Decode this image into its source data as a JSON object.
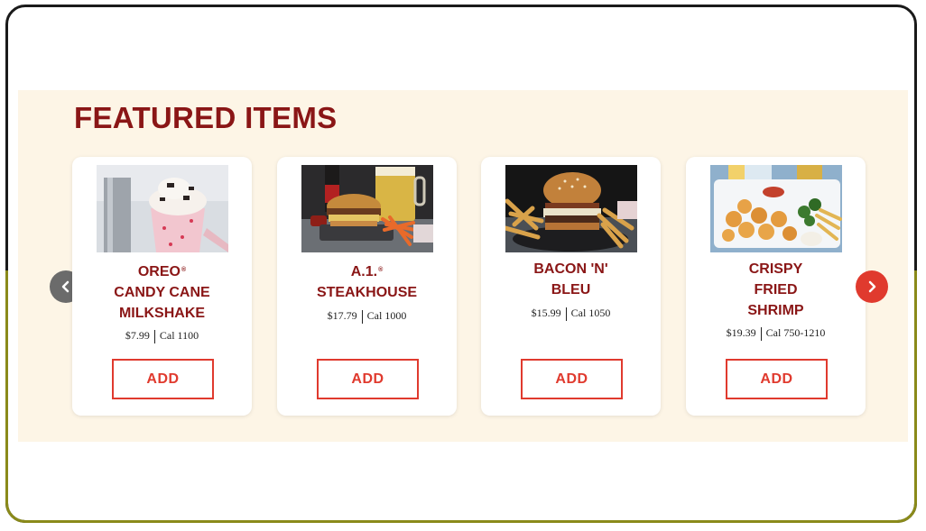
{
  "section": {
    "title": "FEATURED ITEMS"
  },
  "items": [
    {
      "name_lines": [
        "OREO",
        "CANDY CANE",
        "MILKSHAKE"
      ],
      "reg_mark": "®",
      "price": "$7.99",
      "calories": "Cal 1100",
      "add_label": "ADD",
      "image": "milkshake-photo"
    },
    {
      "name_lines": [
        "A.1.",
        "STEAKHOUSE"
      ],
      "reg_mark": "®",
      "price": "$17.79",
      "calories": "Cal 1000",
      "add_label": "ADD",
      "image": "steakhouse-burger-photo"
    },
    {
      "name_lines": [
        "BACON 'N'",
        "BLEU"
      ],
      "price": "$15.99",
      "calories": "Cal 1050",
      "add_label": "ADD",
      "image": "bacon-bleu-burger-photo"
    },
    {
      "name_lines": [
        "CRISPY",
        "FRIED",
        "SHRIMP"
      ],
      "price": "$19.39",
      "calories": "Cal 750-1210",
      "add_label": "ADD",
      "image": "fried-shrimp-photo"
    }
  ],
  "carousel": {
    "prev_icon": "chevron-left-icon",
    "next_icon": "chevron-right-icon"
  },
  "colors": {
    "title": "#8a1616",
    "accent": "#e03a2e",
    "band": "#fdf5e6",
    "prev_button": "#6b6b6b"
  }
}
